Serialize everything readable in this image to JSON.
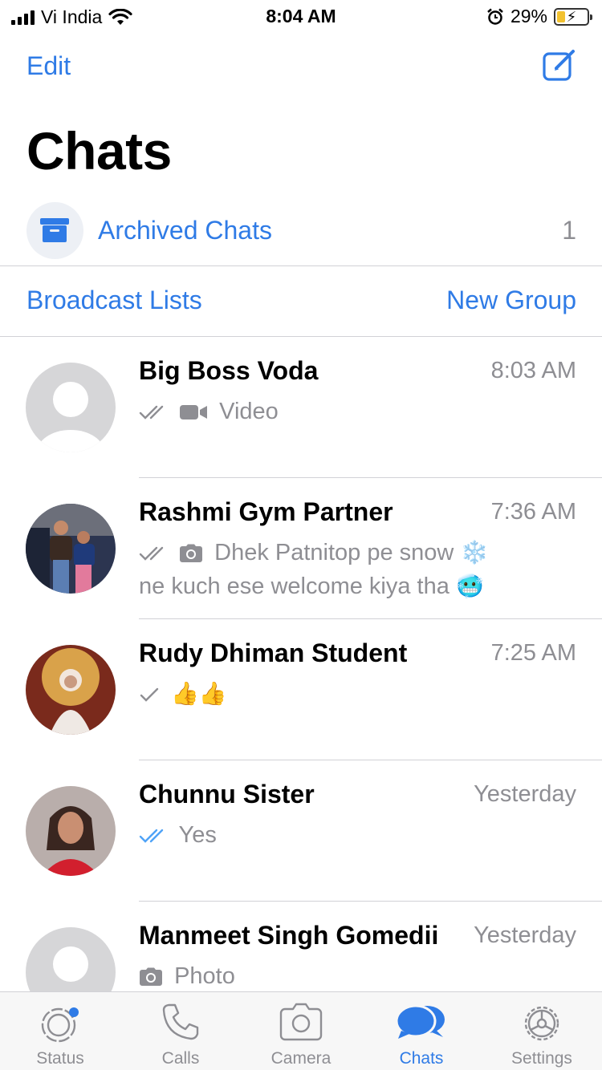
{
  "status_bar": {
    "carrier": "Vi India",
    "time": "8:04 AM",
    "battery": "29%",
    "battery_level": 0.29
  },
  "header": {
    "edit_label": "Edit",
    "title": "Chats"
  },
  "archived": {
    "label": "Archived Chats",
    "count": "1"
  },
  "actions": {
    "broadcast": "Broadcast Lists",
    "new_group": "New Group"
  },
  "chats": [
    {
      "name": "Big Boss Voda",
      "time": "8:03 AM",
      "preview": "Video",
      "ticks": "double-gray",
      "media_icon": "video-icon"
    },
    {
      "name": "Rashmi Gym Partner",
      "time": "7:36 AM",
      "preview_line1": "Dhek Patnitop pe snow",
      "preview_line2": "ne kuch ese welcome kiya tha",
      "emoji1": "❄️",
      "emoji2": "🥶",
      "ticks": "double-gray",
      "media_icon": "camera-icon"
    },
    {
      "name": "Rudy Dhiman Student",
      "time": "7:25 AM",
      "preview": "👍👍",
      "ticks": "single-gray"
    },
    {
      "name": "Chunnu Sister",
      "time": "Yesterday",
      "preview": "Yes",
      "ticks": "double-blue"
    },
    {
      "name": "Manmeet Singh Gomedii",
      "time": "Yesterday",
      "preview": "Photo",
      "media_icon": "camera-icon"
    }
  ],
  "tabs": [
    {
      "label": "Status",
      "icon": "status-icon"
    },
    {
      "label": "Calls",
      "icon": "phone-icon"
    },
    {
      "label": "Camera",
      "icon": "camera-icon"
    },
    {
      "label": "Chats",
      "icon": "chats-icon",
      "active": true
    },
    {
      "label": "Settings",
      "icon": "gear-icon"
    }
  ],
  "colors": {
    "accent": "#2f7be6",
    "secondary_text": "#8e8e93",
    "separator": "#d1d1d6",
    "tab_bar_bg": "#f7f7f7",
    "read_tick": "#4fa3f7"
  }
}
